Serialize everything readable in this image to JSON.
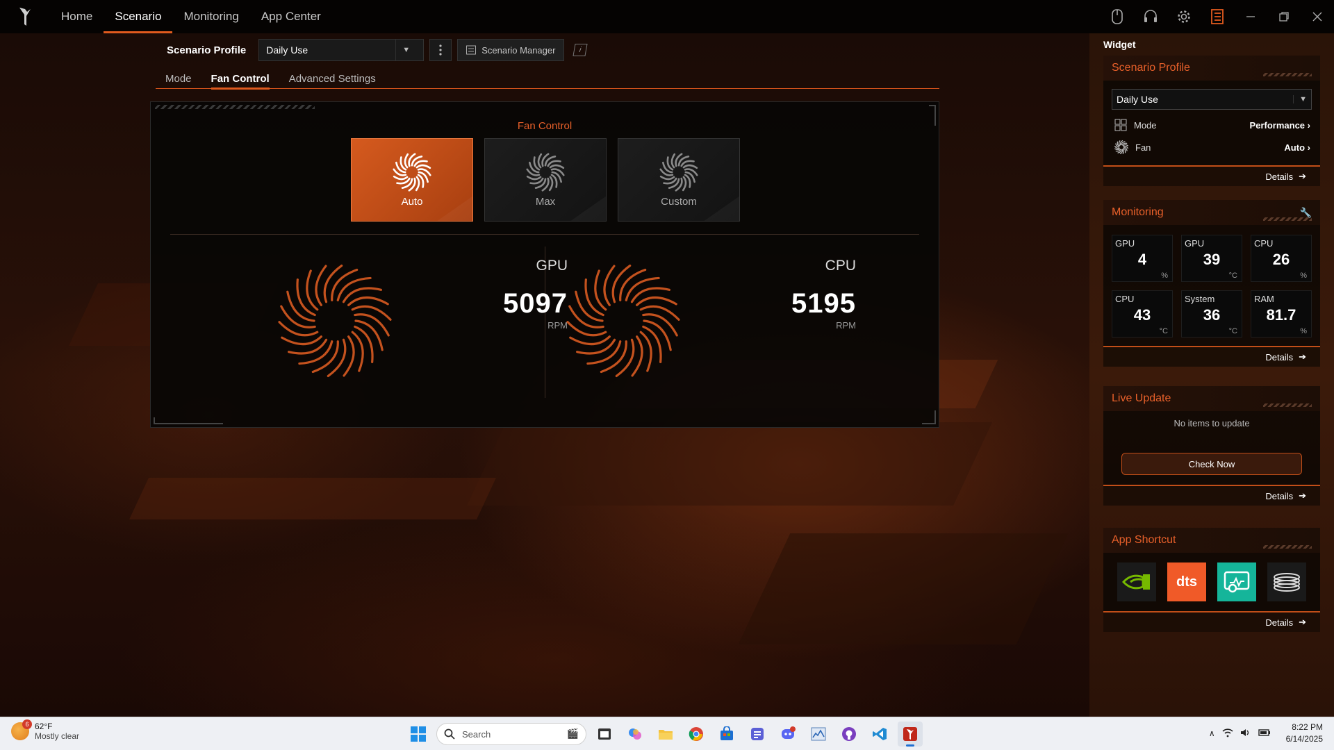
{
  "nav": {
    "items": [
      {
        "label": "Home",
        "active": false
      },
      {
        "label": "Scenario",
        "active": true
      },
      {
        "label": "Monitoring",
        "active": false
      },
      {
        "label": "App Center",
        "active": false
      }
    ]
  },
  "profile": {
    "label": "Scenario Profile",
    "selected": "Daily Use",
    "manager_label": "Scenario Manager"
  },
  "subtabs": [
    {
      "label": "Mode",
      "active": false
    },
    {
      "label": "Fan Control",
      "active": true
    },
    {
      "label": "Advanced Settings",
      "active": false
    }
  ],
  "fan_control": {
    "title": "Fan Control",
    "modes": [
      {
        "label": "Auto",
        "active": true
      },
      {
        "label": "Max",
        "active": false
      },
      {
        "label": "Custom",
        "active": false
      }
    ],
    "gpu": {
      "name": "GPU",
      "rpm": "5097",
      "unit": "RPM"
    },
    "cpu": {
      "name": "CPU",
      "rpm": "5195",
      "unit": "RPM"
    }
  },
  "widget": {
    "title": "Widget",
    "scenario_profile": {
      "title": "Scenario Profile",
      "selected": "Daily Use",
      "mode_label": "Mode",
      "mode_value": "Performance",
      "fan_label": "Fan",
      "fan_value": "Auto",
      "details": "Details"
    },
    "monitoring": {
      "title": "Monitoring",
      "cells": [
        {
          "label": "GPU",
          "value": "4",
          "unit": "%"
        },
        {
          "label": "GPU",
          "value": "39",
          "unit": "°C"
        },
        {
          "label": "CPU",
          "value": "26",
          "unit": "%"
        },
        {
          "label": "CPU",
          "value": "43",
          "unit": "°C"
        },
        {
          "label": "System",
          "value": "36",
          "unit": "°C"
        },
        {
          "label": "RAM",
          "value": "81.7",
          "unit": "%"
        }
      ],
      "details": "Details"
    },
    "live_update": {
      "title": "Live Update",
      "message": "No items to update",
      "button": "Check Now",
      "details": "Details"
    },
    "app_shortcut": {
      "title": "App Shortcut",
      "apps": [
        {
          "icon": "nvidia-icon",
          "bg": "#1a1a1a",
          "fg": "#76b900"
        },
        {
          "icon": "dts-icon",
          "bg": "#f05a28",
          "fg": "#ffffff",
          "text": "dts"
        },
        {
          "icon": "monitor-app-icon",
          "bg": "#15b59a",
          "fg": "#ffffff"
        },
        {
          "icon": "coil-icon",
          "bg": "#1a1a1a",
          "fg": "#d8d8d8"
        }
      ],
      "details": "Details"
    }
  },
  "taskbar": {
    "weather_temp": "62°F",
    "weather_desc": "Mostly clear",
    "weather_badge": "6",
    "search_placeholder": "Search",
    "time": "8:22 PM",
    "date": "6/14/2025"
  },
  "colors": {
    "accent": "#e05a1e",
    "accent_text": "#e8602a",
    "taskbar": "#eef0f4"
  }
}
